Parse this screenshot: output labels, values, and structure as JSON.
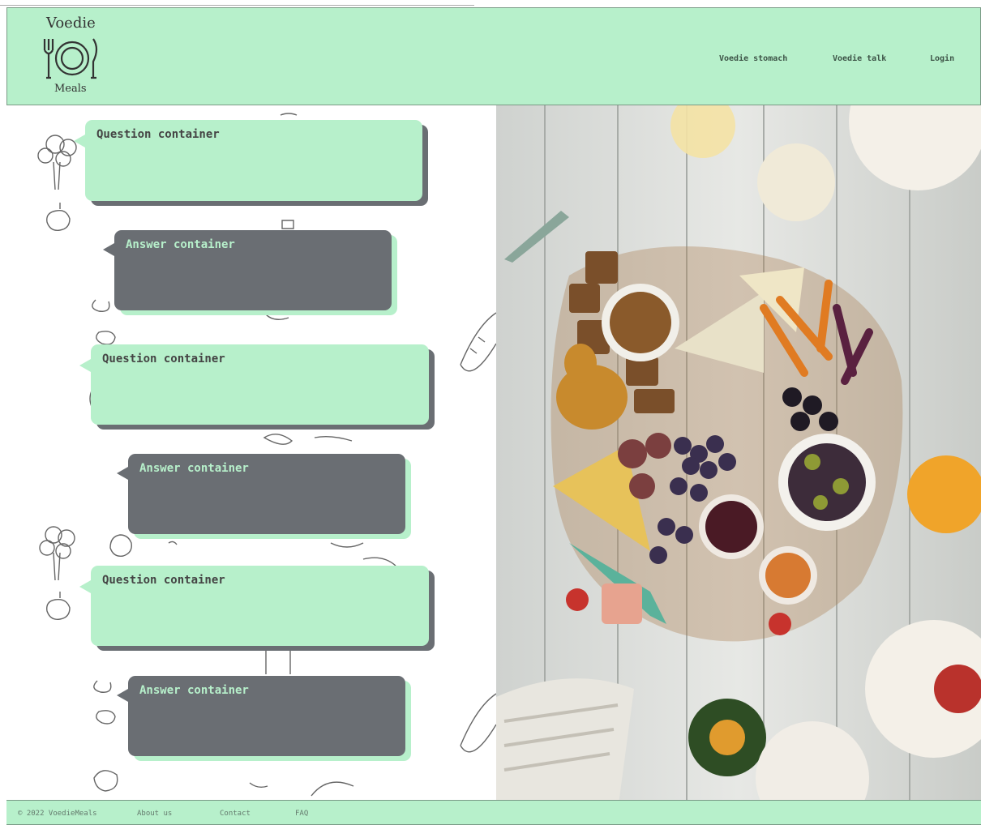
{
  "header": {
    "logo_top": "Voedie",
    "logo_bottom": "Meals",
    "nav": [
      "Voedie stomach",
      "Voedie talk",
      "Login"
    ]
  },
  "chat": [
    {
      "type": "question",
      "text": "Question container"
    },
    {
      "type": "answer",
      "text": "Answer container"
    },
    {
      "type": "question",
      "text": "Question container"
    },
    {
      "type": "answer",
      "text": "Answer container"
    },
    {
      "type": "question",
      "text": "Question container"
    },
    {
      "type": "answer",
      "text": "Answer container"
    }
  ],
  "footer": {
    "copyright": "© 2022 VoedieMeals",
    "links": [
      "About us",
      "Contact",
      "FAQ"
    ]
  },
  "colors": {
    "accent": "#b7f0cb",
    "dark": "#6a6e73"
  }
}
